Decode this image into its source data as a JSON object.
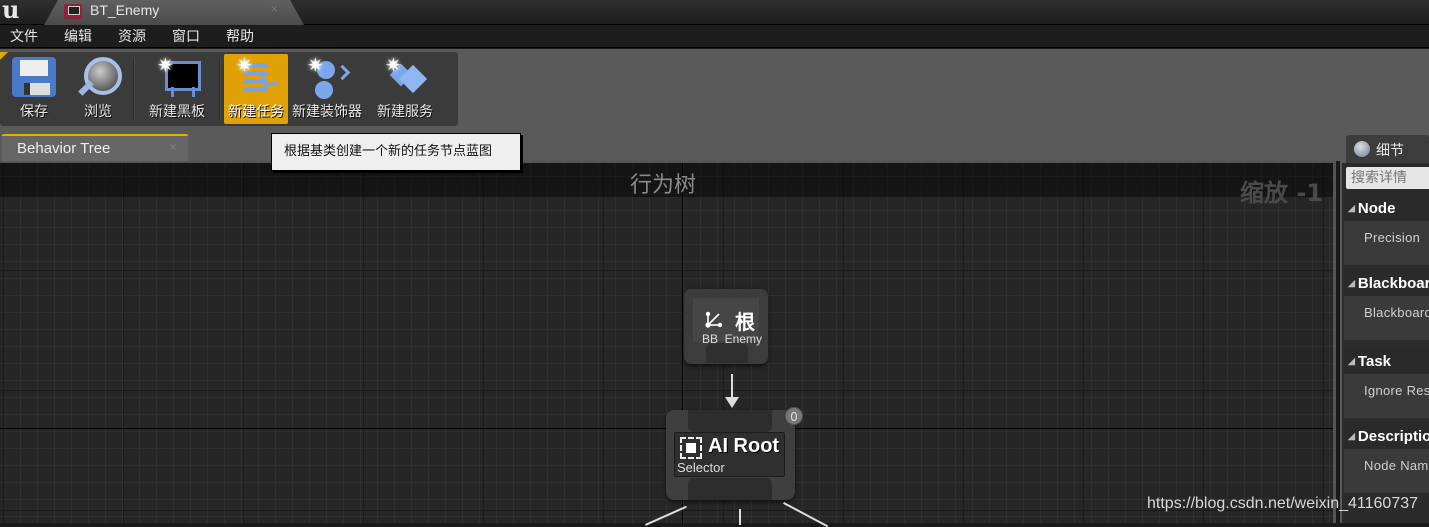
{
  "app": {
    "logo": "u",
    "document_tab": {
      "label": "BT_Enemy",
      "close": "×"
    }
  },
  "menu": [
    "文件",
    "编辑",
    "资源",
    "窗口",
    "帮助"
  ],
  "toolbar": {
    "buttons": [
      {
        "label": "保存",
        "icon": "save-icon"
      },
      {
        "label": "浏览",
        "icon": "browse-icon"
      },
      {
        "label": "新建黑板",
        "icon": "new-blackboard-icon"
      },
      {
        "label": "新建任务",
        "icon": "new-task-icon",
        "active": true
      },
      {
        "label": "新建装饰器",
        "icon": "new-decorator-icon"
      },
      {
        "label": "新建服务",
        "icon": "new-service-icon"
      }
    ],
    "active_color": "#e0a106"
  },
  "tooltip": "根据基类创建一个新的任务节点蓝图",
  "panel_tab": {
    "label": "Behavior Tree",
    "close": "×"
  },
  "graph": {
    "title": "行为树",
    "zoom": "缩放 -1",
    "root_node": {
      "title": "根",
      "subtitle": "BB_Enemy"
    },
    "selector_node": {
      "title": "AI Root",
      "subtitle": "Selector",
      "badge": "0"
    }
  },
  "details": {
    "tab_label": "细节",
    "search_placeholder": "搜索详情",
    "sections": [
      {
        "header": "Node",
        "row": "Precision"
      },
      {
        "header": "Blackboard",
        "row": "Blackboard"
      },
      {
        "header": "Task",
        "row": "Ignore Restart"
      },
      {
        "header": "Description",
        "row": "Node Name"
      }
    ]
  },
  "watermark": "https://blog.csdn.net/weixin_41160737"
}
